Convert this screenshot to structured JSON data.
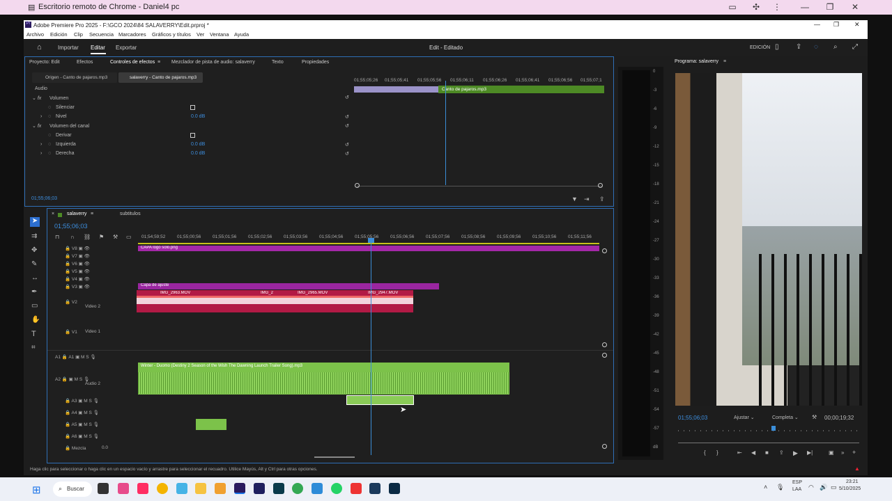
{
  "chrome": {
    "title": "Escritorio remoto de Chrome - Daniel4 pc"
  },
  "app": {
    "title": "Adobe Premiere Pro 2025 - F:\\GCO 2024\\84 SALAVERRY\\Edit.prproj *"
  },
  "menu": [
    "Archivo",
    "Edición",
    "Clip",
    "Secuencia",
    "Marcadores",
    "Gráficos y títulos",
    "Ver",
    "Ventana",
    "Ayuda"
  ],
  "header": {
    "import": "Importar",
    "edit": "Editar",
    "export": "Exportar",
    "center": "Edit - Editado",
    "workspace": "EDICIÓN"
  },
  "effects": {
    "tabs": [
      "Proyecto: Edit",
      "Efectos",
      "Controles de efectos",
      "Mezclador de pista de audio: salaverry",
      "Texto",
      "Propiedades"
    ],
    "source": "Origen - Canto de pajaros.mp3",
    "target": "salaverry - Canto de pajaros.mp3",
    "section": "Audio",
    "volume": "Volumen",
    "bypass": "Silenciar",
    "level": "Nivel",
    "level_val": "0.0 dB",
    "channel": "Volumen del canal",
    "bypass2": "Derivar",
    "left": "Izquierda",
    "left_val": "0.0 dB",
    "right": "Derecha",
    "right_val": "0.0 dB",
    "timecode": "01;55;06;03",
    "mini_ruler": [
      "01;55;05;26",
      "01;55;05;41",
      "01;55;05;56",
      "01;55;06;11",
      "01;55;06;26",
      "01;55;06;41",
      "01;55;06;56",
      "01;55;07;1"
    ],
    "clip": "Canto de pajaros.mp3"
  },
  "timeline": {
    "tabs": [
      "salaverry",
      "subtitulos"
    ],
    "timecode": "01;55;06;03",
    "ruler": [
      "01;54;59;52",
      "01;55;00;56",
      "01;55;01;56",
      "01;55;02;56",
      "01;55;03;56",
      "01;55;04;56",
      "01;55;05;56",
      "01;55;06;56",
      "01;55;07;56",
      "01;55;08;56",
      "01;55;09;56",
      "01;55;10;56",
      "01;55;11;56"
    ],
    "vtracks": [
      "V8",
      "V7",
      "V6",
      "V5",
      "V4",
      "V3",
      "V2",
      "V1"
    ],
    "v2_name": "Video 2",
    "v1_name": "Video 1",
    "atracks": [
      "A1",
      "A2",
      "A3",
      "A4",
      "A5",
      "A6"
    ],
    "a2_name": "Audio 2",
    "mix": "Mezcla",
    "mix_val": "0.0",
    "clips": {
      "logo": "CAPA logo solo.png",
      "adjust": "Capa de ajuste",
      "c1": "IMG_2963.MOV",
      "c2": "IMG_2",
      "c3": "IMG_2965.MOV",
      "c4": "IMG_2947.MOV",
      "audio": "Winter - Duomo (Destiny 2 Season of the Wish The Dawning Launch Trailer Song).mp3"
    }
  },
  "meter": [
    "0",
    "-3",
    "-6",
    "-9",
    "-12",
    "-15",
    "-18",
    "-21",
    "-24",
    "-27",
    "-30",
    "-33",
    "-36",
    "-39",
    "-42",
    "-45",
    "-48",
    "-51",
    "-54",
    "-57",
    "dB"
  ],
  "program": {
    "title": "Programa: salaverry",
    "timecode": "01;55;06;03",
    "fit": "Ajustar",
    "quality": "Completa",
    "duration": "00;00;19;32"
  },
  "status": "Haga clic para seleccionar o haga clic en un espacio vacío y arrastre para seleccionar el recuadro. Utilice Mayús, Alt y Ctrl para otras opciones.",
  "taskbar": {
    "search": "Buscar",
    "lang1": "ESP",
    "lang2": "LAA",
    "time": "23:21",
    "date": "5/10/2025"
  }
}
